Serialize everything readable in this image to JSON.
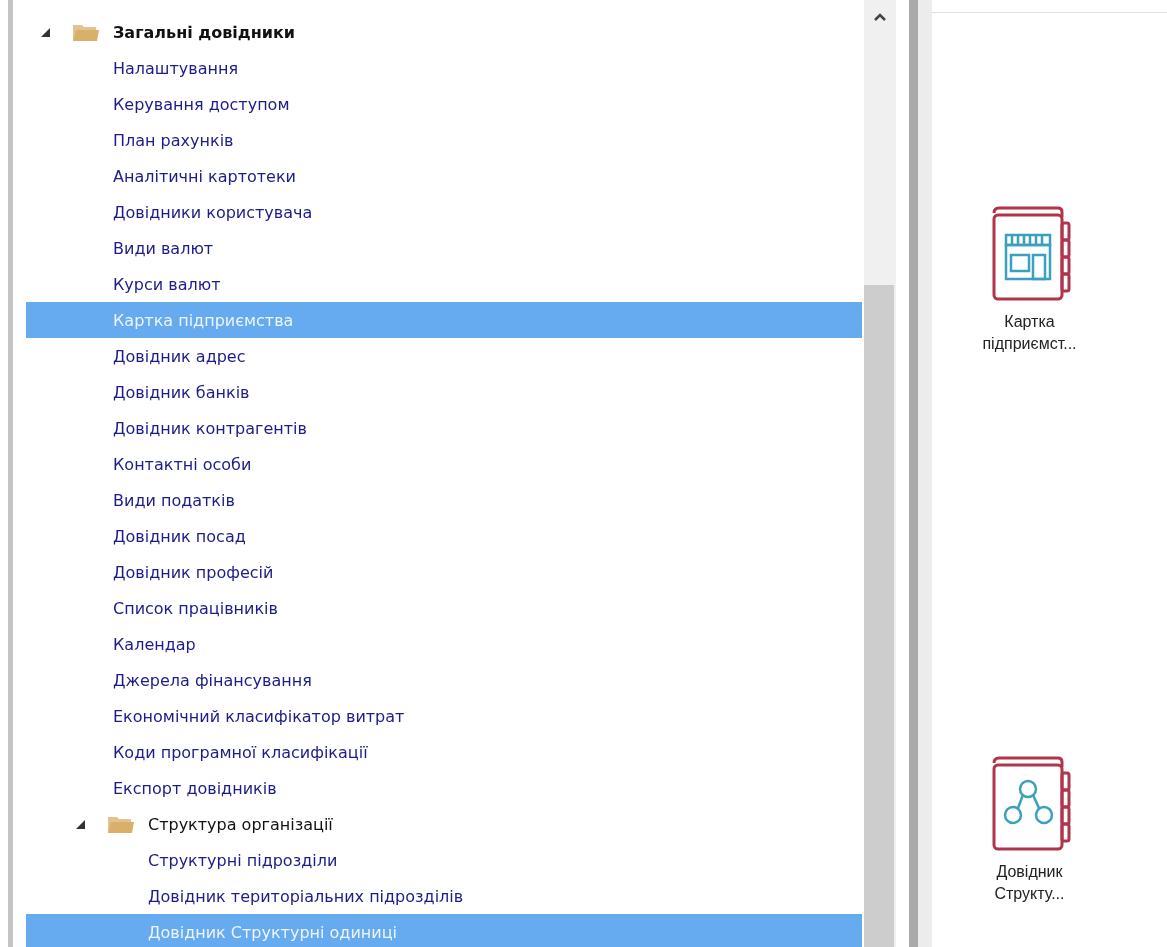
{
  "tree": {
    "items": [
      {
        "label": "Загальні довідники",
        "kind": "folder",
        "expanded": true,
        "selected": false,
        "children": [
          {
            "label": "Налаштування",
            "kind": "item",
            "selected": false
          },
          {
            "label": "Керування доступом",
            "kind": "item",
            "selected": false
          },
          {
            "label": "План рахунків",
            "kind": "item",
            "selected": false
          },
          {
            "label": "Аналітичні картотеки",
            "kind": "item",
            "selected": false
          },
          {
            "label": "Довідники користувача",
            "kind": "item",
            "selected": false
          },
          {
            "label": "Види валют",
            "kind": "item",
            "selected": false
          },
          {
            "label": "Курси валют",
            "kind": "item",
            "selected": false
          },
          {
            "label": "Картка підприємства",
            "kind": "item",
            "selected": true
          },
          {
            "label": "Довідник адрес",
            "kind": "item",
            "selected": false
          },
          {
            "label": "Довідник банків",
            "kind": "item",
            "selected": false
          },
          {
            "label": "Довідник контрагентів",
            "kind": "item",
            "selected": false
          },
          {
            "label": "Контактні особи",
            "kind": "item",
            "selected": false
          },
          {
            "label": "Види податків",
            "kind": "item",
            "selected": false
          },
          {
            "label": "Довідник посад",
            "kind": "item",
            "selected": false
          },
          {
            "label": "Довідник професій",
            "kind": "item",
            "selected": false
          },
          {
            "label": "Список працівників",
            "kind": "item",
            "selected": false
          },
          {
            "label": "Календар",
            "kind": "item",
            "selected": false
          },
          {
            "label": "Джерела фінансування",
            "kind": "item",
            "selected": false
          },
          {
            "label": "Економічний класифікатор витрат",
            "kind": "item",
            "selected": false
          },
          {
            "label": "Коди програмної класифікації",
            "kind": "item",
            "selected": false
          },
          {
            "label": "Експорт довідників",
            "kind": "item",
            "selected": false
          },
          {
            "label": "Структура організації",
            "kind": "folder",
            "expanded": true,
            "selected": false,
            "children": [
              {
                "label": "Структурні підрозділи",
                "kind": "item",
                "selected": false
              },
              {
                "label": "Довідник територіальних підрозділів",
                "kind": "item",
                "selected": false
              },
              {
                "label": "Довідник Структурні одиниці",
                "kind": "item",
                "selected": true
              }
            ]
          }
        ]
      }
    ]
  },
  "shortcuts": [
    {
      "label": "Картка підприємст...",
      "kind": "shop"
    },
    {
      "label": "Довідник Структу...",
      "kind": "hierarchy"
    }
  ]
}
